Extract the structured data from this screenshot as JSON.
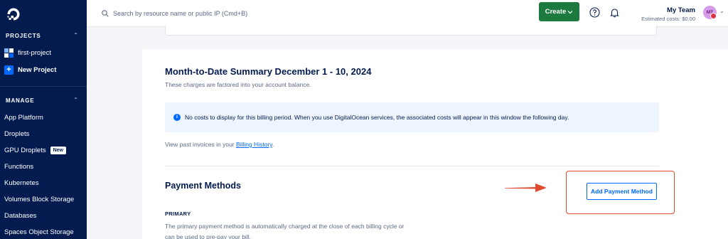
{
  "sidebar": {
    "projects_header": "PROJECTS",
    "projects": [
      {
        "label": "first-project",
        "icon": "project-grid-icon"
      },
      {
        "label": "New Project",
        "icon": "plus-icon"
      }
    ],
    "manage_header": "MANAGE",
    "manage_items": [
      {
        "label": "App Platform"
      },
      {
        "label": "Droplets"
      },
      {
        "label": "GPU Droplets",
        "badge": "New"
      },
      {
        "label": "Functions"
      },
      {
        "label": "Kubernetes"
      },
      {
        "label": "Volumes Block Storage"
      },
      {
        "label": "Databases"
      },
      {
        "label": "Spaces Object Storage"
      }
    ]
  },
  "topbar": {
    "search_placeholder": "Search by resource name or public IP (Cmd+B)",
    "create_label": "Create",
    "team_name": "My Team",
    "estimated_costs": "Estimated costs: $0.00",
    "avatar_initials": "MT"
  },
  "summary": {
    "title": "Month-to-Date Summary December 1 - 10, 2024",
    "subtitle": "These charges are factored into your account balance.",
    "info_message": "No costs to display for this billing period. When you use DigitalOcean services, the associated costs will appear in this window the following day.",
    "invoice_prefix": "View past invoices in your ",
    "invoice_link": "Billing History",
    "invoice_suffix": "."
  },
  "payment": {
    "title": "Payment Methods",
    "add_button": "Add Payment Method",
    "primary_label": "PRIMARY",
    "primary_desc": "The primary payment method is automatically charged at the close of each billing cycle or can be used to pre-pay your bill."
  },
  "colors": {
    "sidebar_bg": "#031b4e",
    "accent_blue": "#0069ff",
    "create_green": "#1d7a3f",
    "highlight_red": "#e04a2f"
  }
}
